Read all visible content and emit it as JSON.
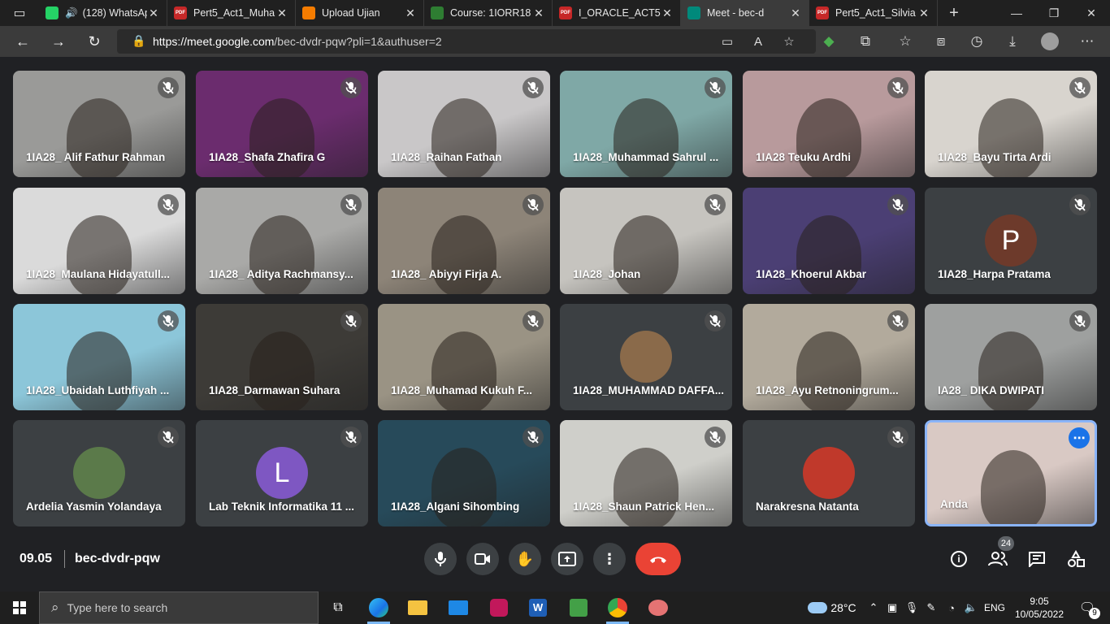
{
  "browser": {
    "tabs": [
      {
        "title": "(128) WhatsApp",
        "favicon": "whatsapp-icon",
        "badge": "99+",
        "audio": true
      },
      {
        "title": "Pert5_Act1_Muha",
        "favicon": "pdf-icon"
      },
      {
        "title": "Upload Ujian",
        "favicon": "moodle-icon"
      },
      {
        "title": "Course: 1IORR18",
        "favicon": "course-icon"
      },
      {
        "title": "I_ORACLE_ACT5.p",
        "favicon": "pdf-icon"
      },
      {
        "title": "Meet - bec-d",
        "favicon": "meet-icon",
        "active": true
      },
      {
        "title": "Pert5_Act1_Silvia",
        "favicon": "pdf-icon"
      }
    ],
    "url_domain": "https://meet.google.com",
    "url_path": "/bec-dvdr-pqw?pli=1&authuser=2"
  },
  "participants": [
    {
      "name": "1IA28_ Alif Fathur Rahman",
      "type": "video",
      "bg": "#9a9a98",
      "muted": true
    },
    {
      "name": "1IA28_Shafa Zhafira G",
      "type": "video",
      "bg": "#6b2c6e",
      "muted": true
    },
    {
      "name": "1IA28_Raihan Fathan",
      "type": "video",
      "bg": "#c9c7c8",
      "muted": true
    },
    {
      "name": "1IA28_Muhammad Sahrul ...",
      "type": "video",
      "bg": "#7fa8a6",
      "muted": true
    },
    {
      "name": "1IA28 Teuku Ardhi",
      "type": "video",
      "bg": "#b89a9c",
      "muted": true
    },
    {
      "name": "1IA28_Bayu Tirta Ardi",
      "type": "video",
      "bg": "#d8d4ce",
      "muted": true
    },
    {
      "name": "1IA28_Maulana Hidayatull...",
      "type": "video",
      "bg": "#dadada",
      "muted": true
    },
    {
      "name": "1IA28_ Aditya Rachmansy...",
      "type": "video",
      "bg": "#a9a9a7",
      "muted": true
    },
    {
      "name": "1IA28_ Abiyyi Firja A.",
      "type": "video",
      "bg": "#8d8478",
      "muted": true
    },
    {
      "name": "1IA28_Johan",
      "type": "video",
      "bg": "#c6c4bf",
      "muted": true
    },
    {
      "name": "1IA28_Khoerul Akbar",
      "type": "video",
      "bg": "#4b3f74",
      "muted": true
    },
    {
      "name": "1IA28_Harpa Pratama",
      "type": "avatar",
      "initial": "P",
      "avatar_color": "#6d3a2b",
      "muted": true
    },
    {
      "name": "1IA28_Ubaidah Luthfiyah ...",
      "type": "video",
      "bg": "#8cc6d9",
      "muted": true
    },
    {
      "name": "1IA28_Darmawan Suhara",
      "type": "video",
      "bg": "#3d3b37",
      "muted": true
    },
    {
      "name": "1IA28_Muhamad Kukuh F...",
      "type": "video",
      "bg": "#9a9384",
      "muted": true
    },
    {
      "name": "1IA28_MUHAMMAD DAFFA...",
      "type": "avatar",
      "initial": "",
      "avatar_color": "#8a6a4a",
      "muted": true
    },
    {
      "name": "1IA28_Ayu Retnoningrum...",
      "type": "video",
      "bg": "#b2aa9c",
      "muted": true
    },
    {
      "name": "IA28_ DIKA DWIPATI",
      "type": "video",
      "bg": "#9ea09f",
      "muted": true
    },
    {
      "name": "Ardelia Yasmin Yolandaya",
      "type": "avatar",
      "initial": "",
      "avatar_color": "#5b7a4a",
      "muted": true
    },
    {
      "name": "Lab Teknik Informatika 11 ...",
      "type": "avatar",
      "initial": "L",
      "avatar_color": "#7e57c2",
      "muted": true
    },
    {
      "name": "1IA28_Algani Sihombing",
      "type": "video",
      "bg": "#274a5a",
      "muted": true
    },
    {
      "name": "1IA28_Shaun Patrick Hen...",
      "type": "video",
      "bg": "#cfcfca",
      "muted": true
    },
    {
      "name": "Narakresna Natanta",
      "type": "avatar",
      "initial": "",
      "avatar_color": "#c0392b",
      "muted": true
    },
    {
      "name": "Anda",
      "type": "video",
      "bg": "#d9c9c4",
      "muted": false,
      "self": true
    }
  ],
  "controls": {
    "time": "09.05",
    "meeting_code": "bec-dvdr-pqw",
    "participant_count": "24"
  },
  "taskbar": {
    "search_placeholder": "Type here to search",
    "weather": "28°C",
    "language": "ENG",
    "time": "9:05",
    "date": "10/05/2022",
    "notification_count": "9"
  }
}
